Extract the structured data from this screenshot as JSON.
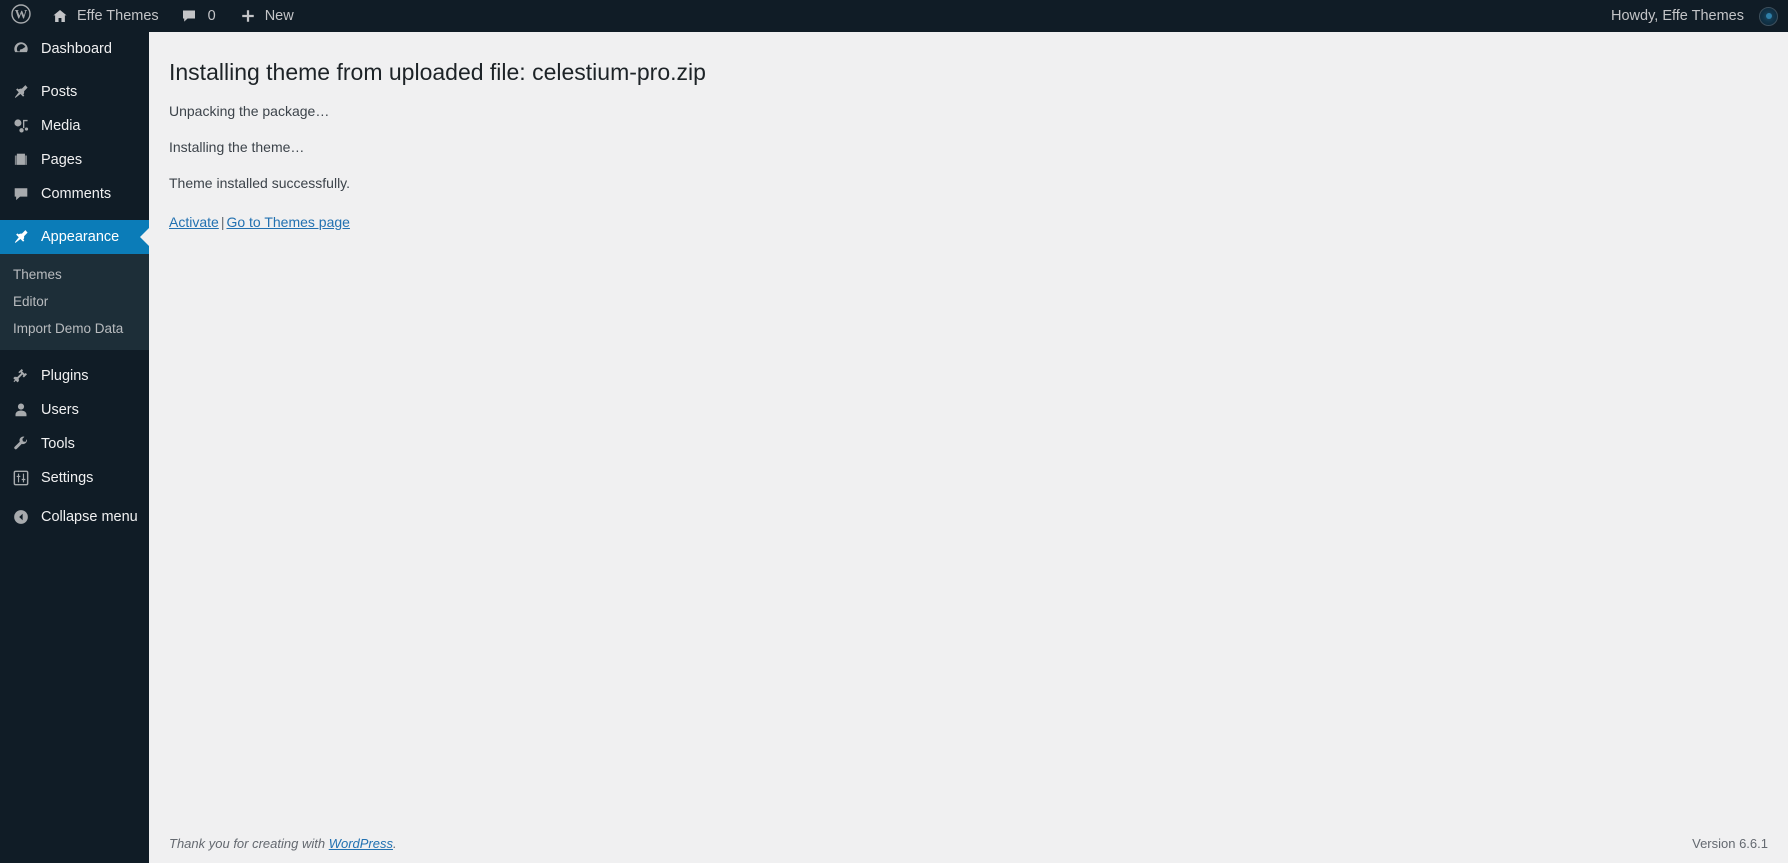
{
  "colors": {
    "adminbar_bg": "#101c26",
    "sidebar_bg": "#101c26",
    "submenu_bg": "#1d2e38",
    "current_blue": "#0b7cb8",
    "content_bg": "#f0f0f1",
    "link_blue": "#2271b1",
    "text_dark": "#1d2327"
  },
  "adminbar": {
    "logo_icon": "wordpress-logo-icon",
    "site_icon": "home-icon",
    "site_name": "Effe Themes",
    "comments_icon": "comment-bubble-icon",
    "comments_count": "0",
    "new_icon": "plus-icon",
    "new_label": "New",
    "howdy": "Howdy, Effe Themes",
    "avatar_icon": "user-avatar"
  },
  "sidebar": {
    "items": [
      {
        "label": "Dashboard",
        "icon": "dashboard-icon",
        "slug": "dashboard",
        "current": false,
        "gap_after": true
      },
      {
        "label": "Posts",
        "icon": "pin-icon",
        "slug": "posts",
        "current": false,
        "gap_after": false
      },
      {
        "label": "Media",
        "icon": "media-icon",
        "slug": "media",
        "current": false,
        "gap_after": false
      },
      {
        "label": "Pages",
        "icon": "pages-icon",
        "slug": "pages",
        "current": false,
        "gap_after": false
      },
      {
        "label": "Comments",
        "icon": "comment-bubble-icon",
        "slug": "comments",
        "current": false,
        "gap_after": true
      },
      {
        "label": "Appearance",
        "icon": "paintbrush-icon",
        "slug": "appearance",
        "current": true,
        "gap_after": false
      },
      {
        "label": "Plugins",
        "icon": "plugin-icon",
        "slug": "plugins",
        "current": false,
        "gap_after": false
      },
      {
        "label": "Users",
        "icon": "user-icon",
        "slug": "users",
        "current": false,
        "gap_after": false
      },
      {
        "label": "Tools",
        "icon": "wrench-icon",
        "slug": "tools",
        "current": false,
        "gap_after": false
      },
      {
        "label": "Settings",
        "icon": "settings-sliders-icon",
        "slug": "settings",
        "current": false,
        "gap_after": false
      }
    ],
    "appearance_submenu": [
      {
        "label": "Themes",
        "current": false
      },
      {
        "label": "Editor",
        "current": false
      },
      {
        "label": "Import Demo Data",
        "current": true
      }
    ],
    "collapse": {
      "label": "Collapse menu",
      "icon": "collapse-arrow-icon"
    }
  },
  "main": {
    "title": "Installing theme from uploaded file: celestium-pro.zip",
    "messages": [
      "Unpacking the package…",
      "Installing the theme…",
      "Theme installed successfully."
    ],
    "actions": {
      "activate_label": "Activate",
      "separator": "|",
      "themes_page_label": "Go to Themes page"
    }
  },
  "footer": {
    "thanks_prefix": "Thank you for creating with ",
    "wordpress_link": "WordPress",
    "thanks_suffix": ".",
    "version": "Version 6.6.1"
  }
}
